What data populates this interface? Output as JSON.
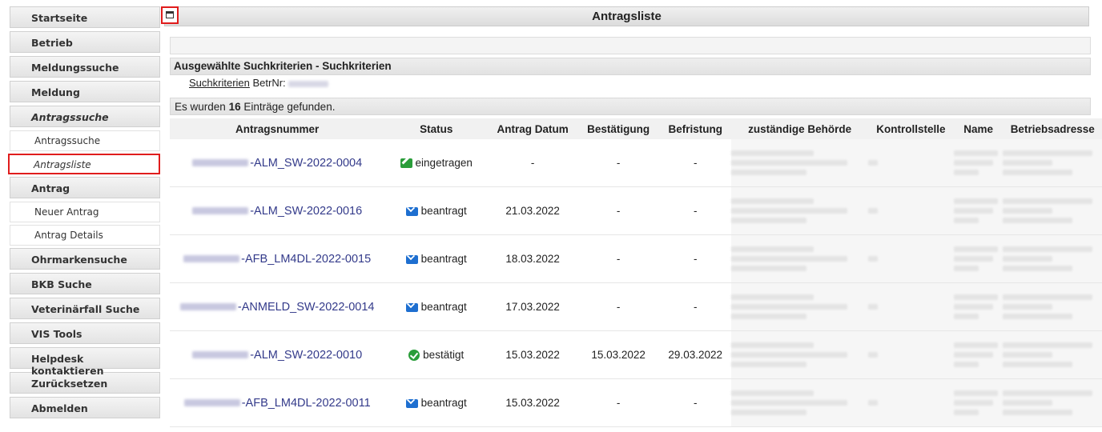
{
  "sidebar": {
    "items": [
      {
        "label": "Startseite",
        "type": "main"
      },
      {
        "label": "Betrieb",
        "type": "main"
      },
      {
        "label": "Meldungssuche",
        "type": "main"
      },
      {
        "label": "Meldung",
        "type": "main"
      },
      {
        "label": "Antragssuche",
        "type": "main",
        "italic": true
      },
      {
        "label": "Antragssuche",
        "type": "sub"
      },
      {
        "label": "Antragsliste",
        "type": "sub",
        "active": true
      },
      {
        "label": "Antrag",
        "type": "main"
      },
      {
        "label": "Neuer Antrag",
        "type": "sub"
      },
      {
        "label": "Antrag Details",
        "type": "sub"
      },
      {
        "label": "Ohrmarkensuche",
        "type": "main"
      },
      {
        "label": "BKB Suche",
        "type": "main"
      },
      {
        "label": "Veterinärfall Suche",
        "type": "main"
      },
      {
        "label": "VIS Tools",
        "type": "main"
      },
      {
        "label": "Helpdesk kontaktieren",
        "type": "main"
      },
      {
        "label": "Zurücksetzen",
        "type": "main"
      },
      {
        "label": "Abmelden",
        "type": "main"
      }
    ]
  },
  "header": {
    "title": "Antragsliste"
  },
  "criteria": {
    "heading": "Ausgewählte Suchkriterien - Suchkriterien",
    "link": "Suchkriterien",
    "label": "BetrNr:"
  },
  "results": {
    "prefix": "Es wurden",
    "count": "16",
    "suffix": "Einträge gefunden."
  },
  "table": {
    "columns": [
      "Antragsnummer",
      "Status",
      "Antrag Datum",
      "Bestätigung",
      "Befristung",
      "zuständige Behörde",
      "Kontrollstelle",
      "Name",
      "Betriebsadresse"
    ],
    "rows": [
      {
        "num": "-ALM_SW-2022-0004",
        "status": "eingetragen",
        "icon": "edit-icon",
        "datum": "-",
        "best": "-",
        "befr": "-"
      },
      {
        "num": "-ALM_SW-2022-0016",
        "status": "beantragt",
        "icon": "mail-icon",
        "datum": "21.03.2022",
        "best": "-",
        "befr": "-"
      },
      {
        "num": "-AFB_LM4DL-2022-0015",
        "status": "beantragt",
        "icon": "mail-icon",
        "datum": "18.03.2022",
        "best": "-",
        "befr": "-"
      },
      {
        "num": "-ANMELD_SW-2022-0014",
        "status": "beantragt",
        "icon": "mail-icon",
        "datum": "17.03.2022",
        "best": "-",
        "befr": "-"
      },
      {
        "num": "-ALM_SW-2022-0010",
        "status": "bestätigt",
        "icon": "check-circle-icon",
        "datum": "15.03.2022",
        "best": "15.03.2022",
        "befr": "29.03.2022"
      },
      {
        "num": "-AFB_LM4DL-2022-0011",
        "status": "beantragt",
        "icon": "mail-icon",
        "datum": "15.03.2022",
        "best": "-",
        "befr": "-"
      }
    ]
  },
  "colors": {
    "highlight": "#e01c1c",
    "link": "#333a8a",
    "success": "#2a9d3a",
    "info": "#1e6fd0"
  }
}
